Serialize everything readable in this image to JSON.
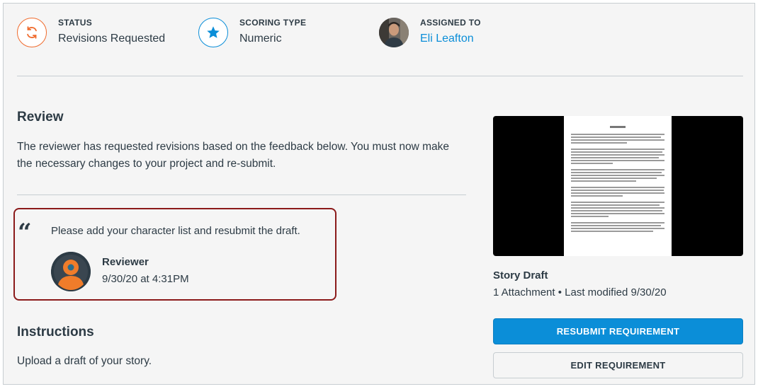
{
  "header": {
    "status": {
      "label": "STATUS",
      "value": "Revisions Requested",
      "icon": "refresh-icon",
      "color": "#f06b2d"
    },
    "scoring": {
      "label": "SCORING TYPE",
      "value": "Numeric",
      "icon": "star-icon",
      "color": "#0b8ed8"
    },
    "assigned": {
      "label": "ASSIGNED TO",
      "value": "Eli Leafton",
      "icon": "user-avatar",
      "color": "#0b8ed8"
    }
  },
  "review": {
    "title": "Review",
    "text": "The reviewer has requested revisions based on the feedback below. You must now make the necessary changes to your project and re-submit."
  },
  "comment": {
    "quote_glyph": "“",
    "text": "Please add your character list and resubmit the draft.",
    "author": "Reviewer",
    "date": "9/30/20 at 4:31PM",
    "highlight_color": "#8b1a1a"
  },
  "instructions": {
    "title": "Instructions",
    "text": "Upload a draft of your story."
  },
  "attachment": {
    "title": "Story Draft",
    "meta": "1 Attachment • Last modified 9/30/20"
  },
  "actions": {
    "resubmit": "RESUBMIT REQUIREMENT",
    "edit": "EDIT REQUIREMENT"
  }
}
